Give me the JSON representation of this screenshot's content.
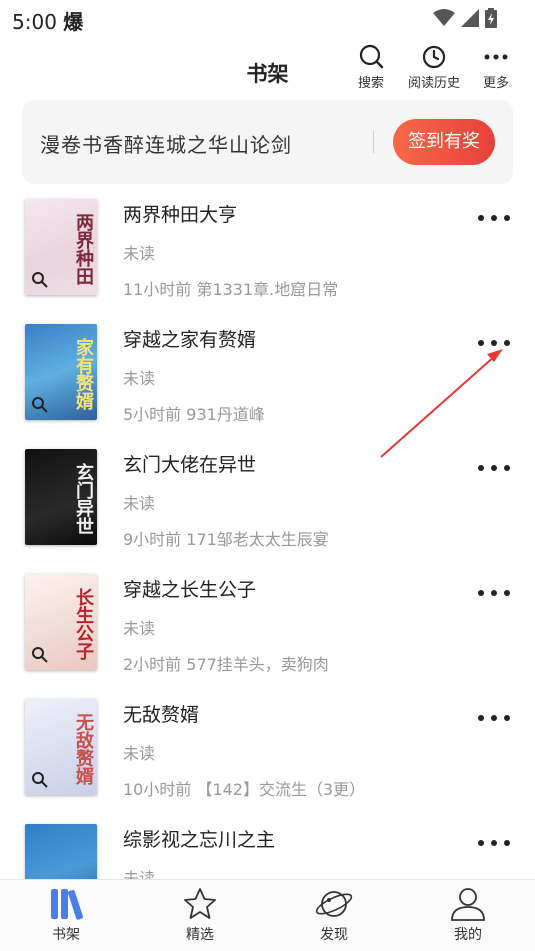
{
  "status_bar": {
    "time": "5:00",
    "app_glyph": "爆"
  },
  "header": {
    "title": "书架",
    "actions": [
      {
        "label": "搜索",
        "icon": "search-icon"
      },
      {
        "label": "阅读历史",
        "icon": "clock-icon"
      },
      {
        "label": "更多",
        "icon": "more-icon"
      }
    ]
  },
  "banner": {
    "text": "漫卷书香醉连城之华山论剑",
    "button": "签到有奖"
  },
  "books": [
    {
      "title": "两界种田大亨",
      "status": "未读",
      "progress": "11小时前 第1331章.地窟日常",
      "cover_text": "两界种田"
    },
    {
      "title": "穿越之家有赘婿",
      "status": "未读",
      "progress": "5小时前 931丹道峰",
      "cover_text": "家有赘婿"
    },
    {
      "title": "玄门大佬在异世",
      "status": "未读",
      "progress": "9小时前 171邹老太太生辰宴",
      "cover_text": "玄门异世"
    },
    {
      "title": "穿越之长生公子",
      "status": "未读",
      "progress": "2小时前 577挂羊头，卖狗肉",
      "cover_text": "长生公子"
    },
    {
      "title": "无敌赘婿",
      "status": "未读",
      "progress": "10小时前 【142】交流生（3更）",
      "cover_text": "无敌赘婿"
    },
    {
      "title": "综影视之忘川之主",
      "status": "未读",
      "progress": "",
      "cover_text": ""
    }
  ],
  "tabs": [
    {
      "label": "书架",
      "icon": "bookshelf-icon",
      "active": true
    },
    {
      "label": "精选",
      "icon": "star-icon",
      "active": false
    },
    {
      "label": "发现",
      "icon": "planet-icon",
      "active": false
    },
    {
      "label": "我的",
      "icon": "user-icon",
      "active": false
    }
  ],
  "colors": {
    "accent": "#e8403a",
    "tab_active": "#4a7fe8",
    "annotation_arrow": "#e53935"
  }
}
